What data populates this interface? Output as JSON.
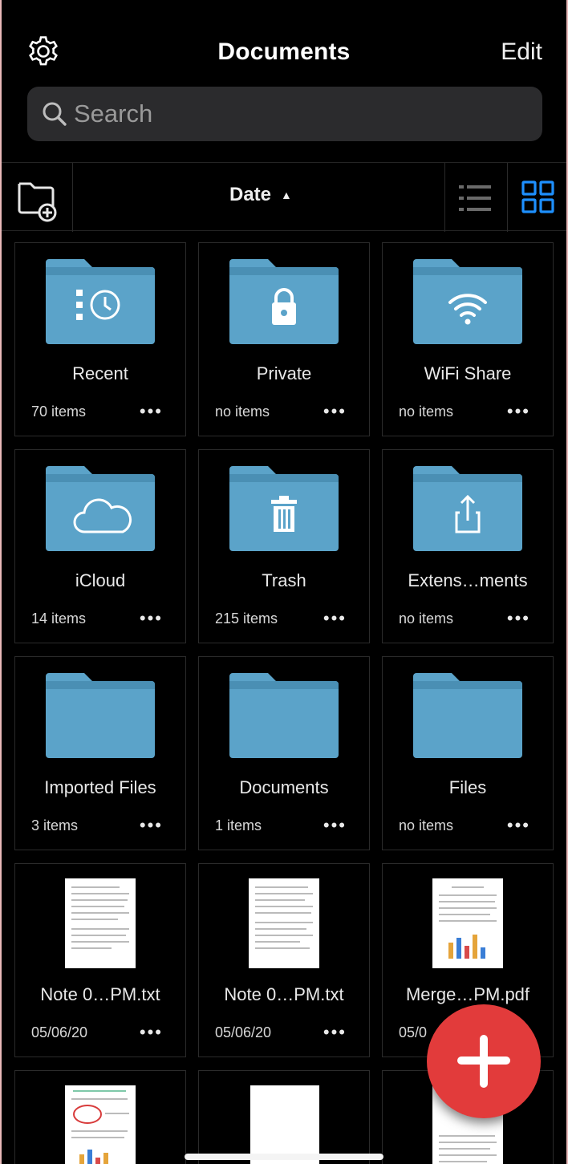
{
  "header": {
    "title": "Documents",
    "edit_label": "Edit",
    "settings_icon": "gear-icon"
  },
  "search": {
    "placeholder": "Search",
    "value": ""
  },
  "toolbar": {
    "new_folder_icon": "new-folder-icon",
    "sort_label": "Date",
    "sort_direction_icon": "caret-up-icon",
    "list_view_icon": "list-view-icon",
    "grid_view_icon": "grid-view-icon",
    "active_view": "grid"
  },
  "colors": {
    "folder": "#5ba3c9",
    "accent": "#1e90ff",
    "fab": "#e23b3b",
    "background": "#000000"
  },
  "items": [
    {
      "label": "Recent",
      "meta": "70 items",
      "kind": "folder",
      "icon": "recent-clock-icon"
    },
    {
      "label": "Private",
      "meta": "no items",
      "kind": "folder",
      "icon": "lock-icon"
    },
    {
      "label": "WiFi Share",
      "meta": "no items",
      "kind": "folder",
      "icon": "wifi-icon"
    },
    {
      "label": "iCloud",
      "meta": "14 items",
      "kind": "folder",
      "icon": "cloud-icon"
    },
    {
      "label": "Trash",
      "meta": "215 items",
      "kind": "folder",
      "icon": "trash-icon"
    },
    {
      "label": "Extens…ments",
      "meta": "no items",
      "kind": "folder",
      "icon": "share-icon"
    },
    {
      "label": "Imported Files",
      "meta": "3 items",
      "kind": "folder",
      "icon": "folder-icon"
    },
    {
      "label": "Documents",
      "meta": "1 items",
      "kind": "folder",
      "icon": "folder-icon"
    },
    {
      "label": "Files",
      "meta": "no items",
      "kind": "folder",
      "icon": "folder-icon"
    },
    {
      "label": "Note 0…PM.txt",
      "meta": "05/06/20",
      "kind": "file",
      "icon": "text-file-thumbnail"
    },
    {
      "label": "Note 0…PM.txt",
      "meta": "05/06/20",
      "kind": "file",
      "icon": "text-file-thumbnail"
    },
    {
      "label": "Merge…PM.pdf",
      "meta": "05/0",
      "kind": "file",
      "icon": "pdf-file-thumbnail"
    }
  ],
  "more_label": "•••",
  "fab": {
    "icon": "plus-icon"
  }
}
